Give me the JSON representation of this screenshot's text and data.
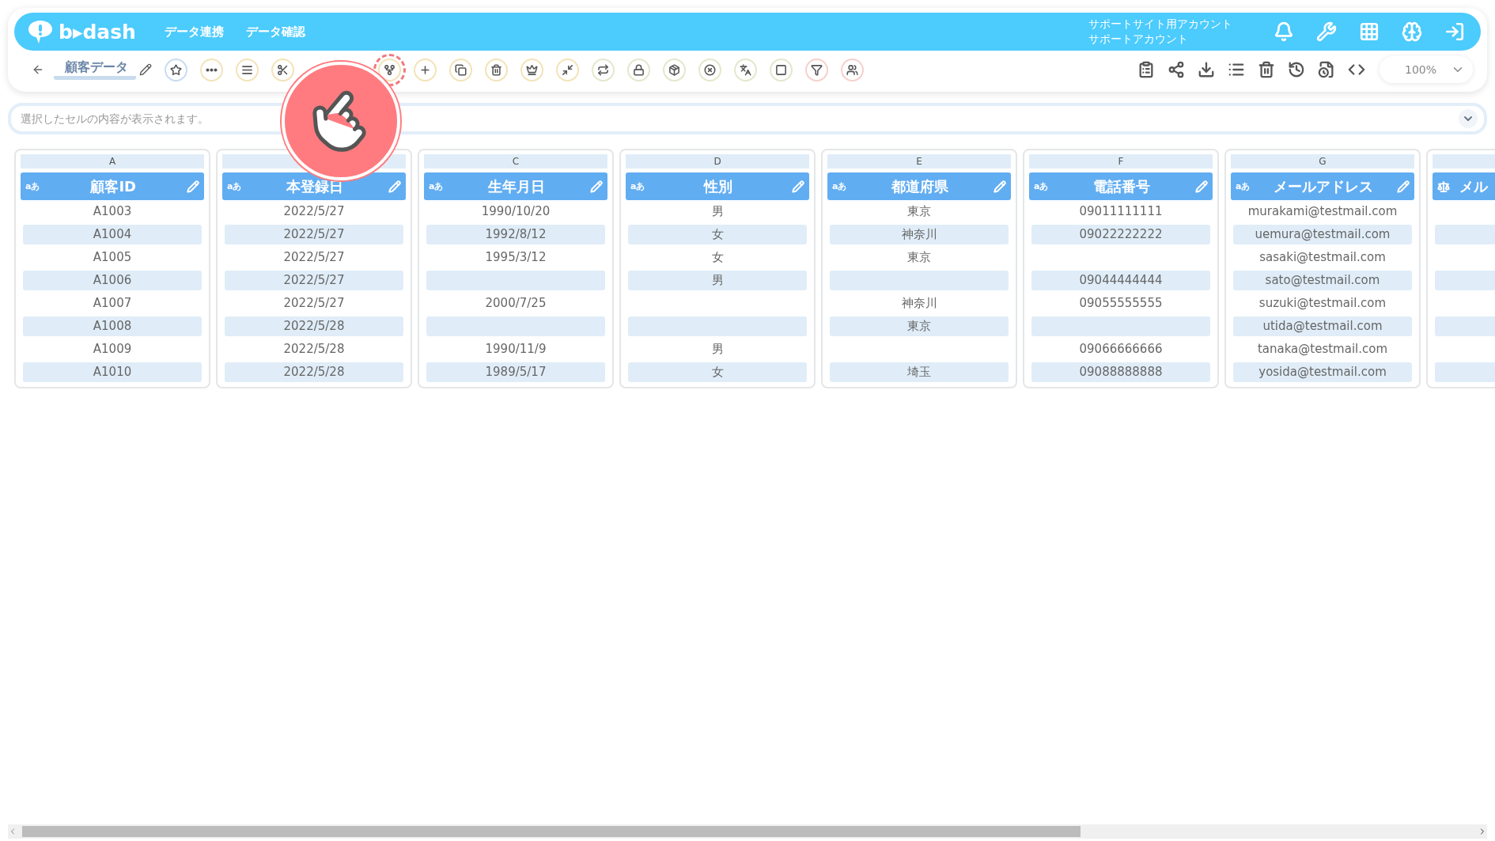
{
  "header": {
    "logo": "b▸dash",
    "nav": [
      {
        "label": "データ連携"
      },
      {
        "label": "データ確認"
      }
    ],
    "account": [
      "サポートサイト用アカウント",
      "サポートアカウント"
    ]
  },
  "toolbar": {
    "title": "顧客データ",
    "tools": [
      {
        "color": "#c9dcf0",
        "highlighted": false
      },
      {
        "color": "#f3e3b8",
        "highlighted": false
      },
      {
        "color": "#f3e3b8",
        "highlighted": false
      },
      {
        "color": "#f3e3b8",
        "highlighted": false
      },
      {
        "color": "#f3e3b8",
        "highlighted": true
      },
      {
        "color": "#f3e3b8",
        "highlighted": false
      },
      {
        "color": "#f3e3b8",
        "highlighted": false
      },
      {
        "color": "#f3e3b8",
        "highlighted": false
      },
      {
        "color": "#f3e3b8",
        "highlighted": false
      },
      {
        "color": "#f3e3b8",
        "highlighted": false
      },
      {
        "color": "#e3e8cc",
        "highlighted": false
      },
      {
        "color": "#e3e8cc",
        "highlighted": false
      },
      {
        "color": "#e3e8cc",
        "highlighted": false
      },
      {
        "color": "#e3e8cc",
        "highlighted": false
      },
      {
        "color": "#e3e8cc",
        "highlighted": false
      },
      {
        "color": "#e3e8cc",
        "highlighted": false
      },
      {
        "color": "#f6d0cc",
        "highlighted": false
      },
      {
        "color": "#f6d0cc",
        "highlighted": false
      }
    ],
    "zoom": "100%"
  },
  "formula_bar": {
    "placeholder": "選択したセルの内容が表示されます。"
  },
  "columns": [
    {
      "letter": "A",
      "name": "顧客ID",
      "kind": "text",
      "badge": "aあ",
      "cells": [
        "A1003",
        "A1004",
        "A1005",
        "A1006",
        "A1007",
        "A1008",
        "A1009",
        "A1010"
      ]
    },
    {
      "name": "本登録日",
      "kind": "text",
      "badge": "aあ",
      "cells": [
        "2022/5/27",
        "2022/5/27",
        "2022/5/27",
        "2022/5/27",
        "2022/5/27",
        "2022/5/28",
        "2022/5/28",
        "2022/5/28"
      ]
    },
    {
      "letter": "C",
      "name": "生年月日",
      "kind": "text",
      "badge": "aあ",
      "cells": [
        "1990/10/20",
        "1992/8/12",
        "1995/3/12",
        null,
        "2000/7/25",
        null,
        "1990/11/9",
        "1989/5/17"
      ]
    },
    {
      "letter": "D",
      "name": "性別",
      "kind": "text",
      "badge": "aあ",
      "cells": [
        "男",
        "女",
        "女",
        "男",
        null,
        null,
        "男",
        "女"
      ]
    },
    {
      "letter": "E",
      "name": "都道府県",
      "kind": "text",
      "badge": "aあ",
      "cells": [
        "東京",
        "神奈川",
        "東京",
        null,
        "神奈川",
        "東京",
        null,
        "埼玉"
      ]
    },
    {
      "letter": "F",
      "name": "電話番号",
      "kind": "text",
      "badge": "aあ",
      "cells": [
        "09011111111",
        "09022222222",
        null,
        "09044444444",
        "09055555555",
        null,
        "09066666666",
        "09088888888"
      ]
    },
    {
      "letter": "G",
      "name": "メールアドレス",
      "kind": "text",
      "badge": "aあ",
      "cells": [
        "murakami@testmail.com",
        "uemura@testmail.com",
        "sasaki@testmail.com",
        "sato@testmail.com",
        "suzuki@testmail.com",
        "utida@testmail.com",
        "tanaka@testmail.com",
        "yosida@testmail.com"
      ]
    },
    {
      "name": "メル",
      "kind": "formula",
      "cells": [
        null,
        null,
        null,
        null,
        null,
        null,
        null,
        null
      ]
    }
  ]
}
